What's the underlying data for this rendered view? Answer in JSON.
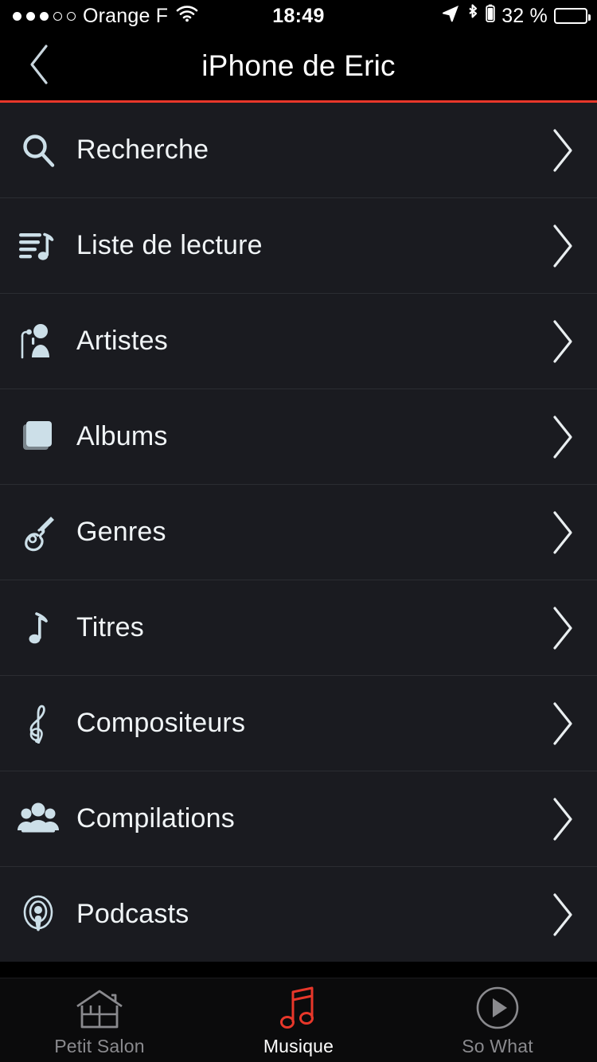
{
  "status_bar": {
    "signal_dots": {
      "filled": 3,
      "hollow": 2
    },
    "carrier": "Orange F",
    "wifi_icon": "wifi-icon",
    "time": "18:49",
    "location_icon": "location-arrow-icon",
    "bluetooth_icon": "bluetooth-icon",
    "bluetooth_battery_icon": "bluetooth-battery-icon",
    "battery_percent": "32 %",
    "battery_level": 32
  },
  "navbar": {
    "back_icon": "chevron-left-icon",
    "title": "iPhone de Eric",
    "accent_color": "#e8372a"
  },
  "list": {
    "chevron_icon": "chevron-right-icon",
    "items": [
      {
        "label": "Recherche",
        "icon": "search-icon"
      },
      {
        "label": "Liste de lecture",
        "icon": "playlist-icon"
      },
      {
        "label": "Artistes",
        "icon": "artist-microphone-icon"
      },
      {
        "label": "Albums",
        "icon": "albums-stack-icon"
      },
      {
        "label": "Genres",
        "icon": "guitar-icon"
      },
      {
        "label": "Titres",
        "icon": "music-note-icon"
      },
      {
        "label": "Compositeurs",
        "icon": "treble-clef-icon"
      },
      {
        "label": "Compilations",
        "icon": "people-group-icon"
      },
      {
        "label": "Podcasts",
        "icon": "podcast-icon"
      }
    ]
  },
  "tabbar": {
    "active_color": "#e8372a",
    "inactive_color": "#8a8a8e",
    "tabs": [
      {
        "label": "Petit Salon",
        "icon": "house-icon",
        "active": false
      },
      {
        "label": "Musique",
        "icon": "music-notes-icon",
        "active": true
      },
      {
        "label": "So What",
        "icon": "play-circle-icon",
        "active": false
      }
    ]
  }
}
